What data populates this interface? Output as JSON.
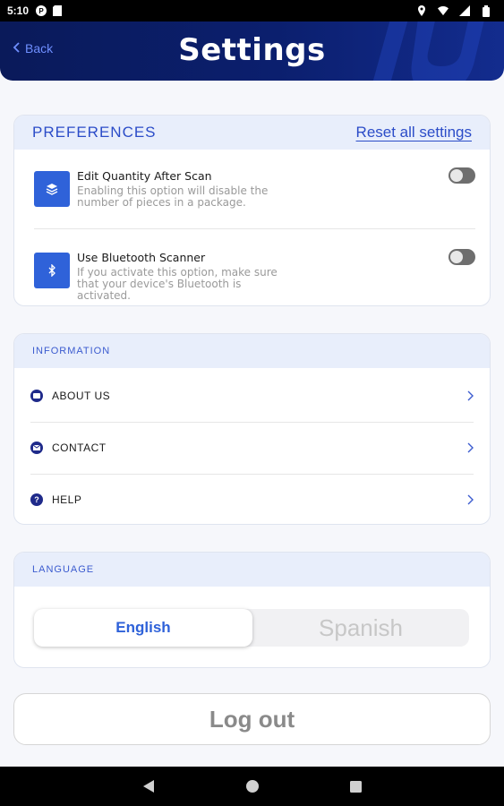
{
  "status_bar": {
    "time": "5:10"
  },
  "header": {
    "back_label": "Back",
    "title": "Settings"
  },
  "preferences": {
    "section_title": "PREFERENCES",
    "reset_label": "Reset all settings",
    "items": [
      {
        "title": "Edit Quantity After Scan",
        "description": "Enabling this option will disable the number of pieces in a package.",
        "enabled": false,
        "icon": "layers-icon"
      },
      {
        "title": "Use Bluetooth Scanner",
        "description": "If you activate this option, make sure that your device's Bluetooth is activated.",
        "enabled": false,
        "icon": "bluetooth-icon"
      }
    ]
  },
  "information": {
    "section_title": "INFORMATION",
    "items": [
      {
        "label": "ABOUT US",
        "icon": "about-icon"
      },
      {
        "label": "CONTACT",
        "icon": "mail-icon"
      },
      {
        "label": "HELP",
        "icon": "help-icon"
      }
    ]
  },
  "language": {
    "section_title": "LANGUAGE",
    "options": [
      "English",
      "Spanish"
    ],
    "selected": "English"
  },
  "logout_label": "Log out",
  "colors": {
    "header": "#0b1f6e",
    "accent": "#2f62d9",
    "section_bg": "#e8eefb"
  }
}
